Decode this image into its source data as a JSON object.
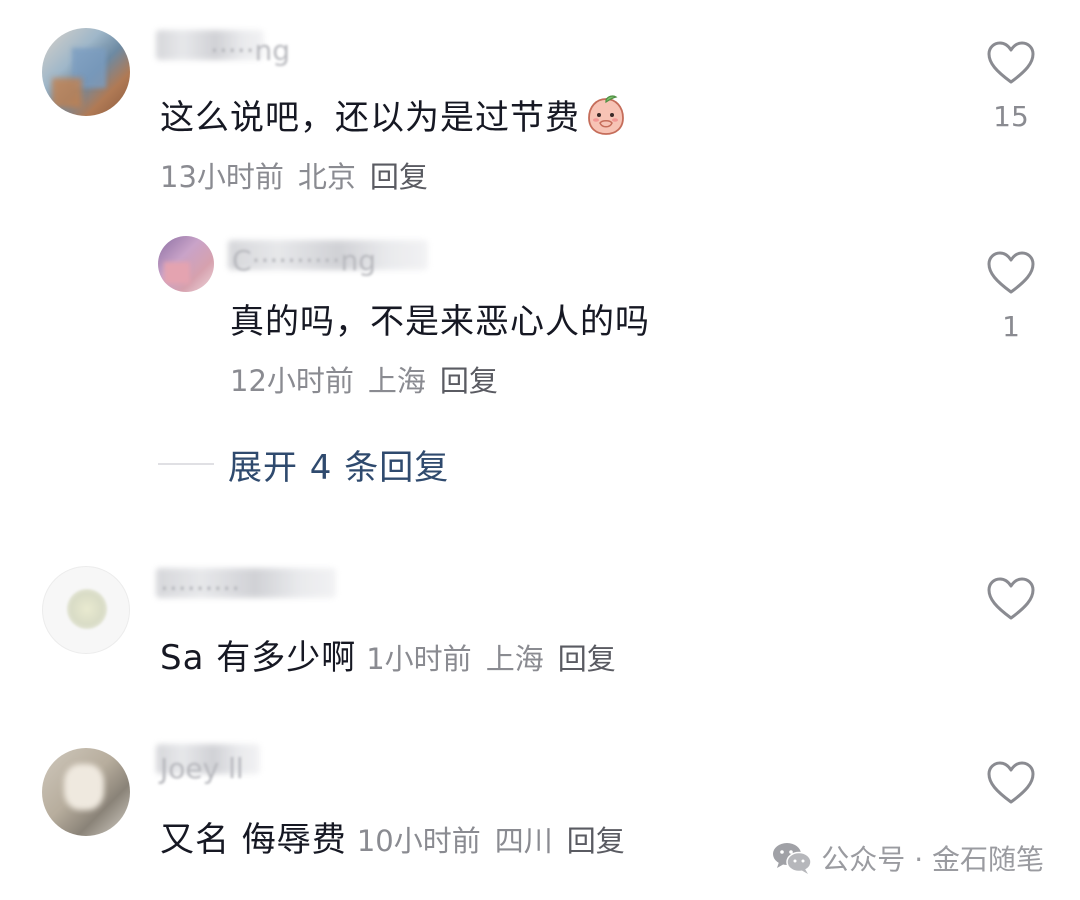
{
  "comments": [
    {
      "username": "·····ng",
      "text": "这么说吧，还以为是过节费",
      "emoji": "peach-cover-mouth-sticker",
      "time": "13小时前",
      "location": "北京",
      "reply": "回复",
      "likes": "15"
    },
    {
      "username": "C··········ng",
      "text": "真的吗，不是来恶心人的吗",
      "time": "12小时前",
      "location": "上海",
      "reply": "回复",
      "likes": "1"
    },
    {
      "username": "·········",
      "text": "Sa 有多少啊",
      "time": "1小时前",
      "location": "上海",
      "reply": "回复",
      "likes": ""
    },
    {
      "username": "Joey ll",
      "text": "又名 侮辱费",
      "time": "10小时前",
      "location": "四川",
      "reply": "回复",
      "likes": ""
    }
  ],
  "expand_replies": "展开 4 条回复",
  "watermark": {
    "icon": "wechat-icon",
    "text": "公众号 · 金石随笔"
  },
  "colors": {
    "text": "#161823",
    "meta": "#8a8b91",
    "link": "#2f4a6e",
    "like_outline": "#8a8b91"
  }
}
